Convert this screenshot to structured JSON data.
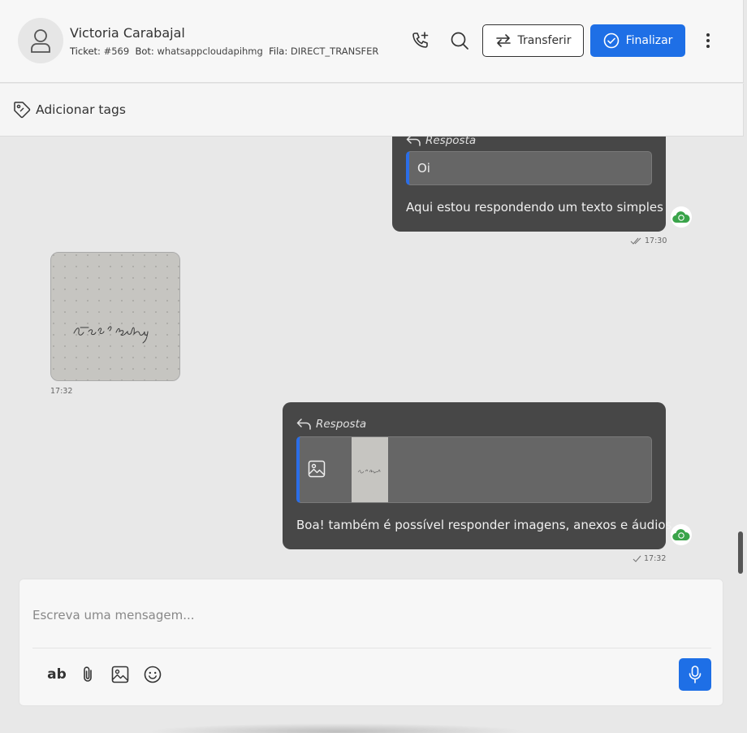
{
  "header": {
    "contact_name": "Victoria Carabajal",
    "ticket_label": "Ticket:",
    "ticket_value": "#569",
    "bot_label": "Bot:",
    "bot_value": "whatsappcloudapihmg",
    "queue_label": "Fila:",
    "queue_value": "DIRECT_TRANSFER",
    "transfer_label": "Transferir",
    "finish_label": "Finalizar",
    "accent_color": "#1e6fe6"
  },
  "tags": {
    "add_label": "Adicionar tags"
  },
  "messages": [
    {
      "direction": "outgoing",
      "reply_label": "Resposta",
      "quoted_text": "Oi",
      "text": "Aqui estou respondendo um texto simples",
      "time": "17:30",
      "status_icon": "double-check-icon"
    },
    {
      "direction": "incoming",
      "type": "image",
      "image_text": "teste reply",
      "time": "17:32"
    },
    {
      "direction": "outgoing",
      "reply_label": "Resposta",
      "quoted_type": "image",
      "quoted_image_text": "teste reply",
      "text": "Boa! também é possível responder imagens, anexos e áudios.",
      "time": "17:32",
      "status_icon": "single-check-icon"
    }
  ],
  "composer": {
    "placeholder": "Escreva uma mensagem...",
    "tools": [
      "format-text-icon",
      "paperclip-icon",
      "image-icon",
      "emoji-icon"
    ],
    "format_label": "ab"
  }
}
